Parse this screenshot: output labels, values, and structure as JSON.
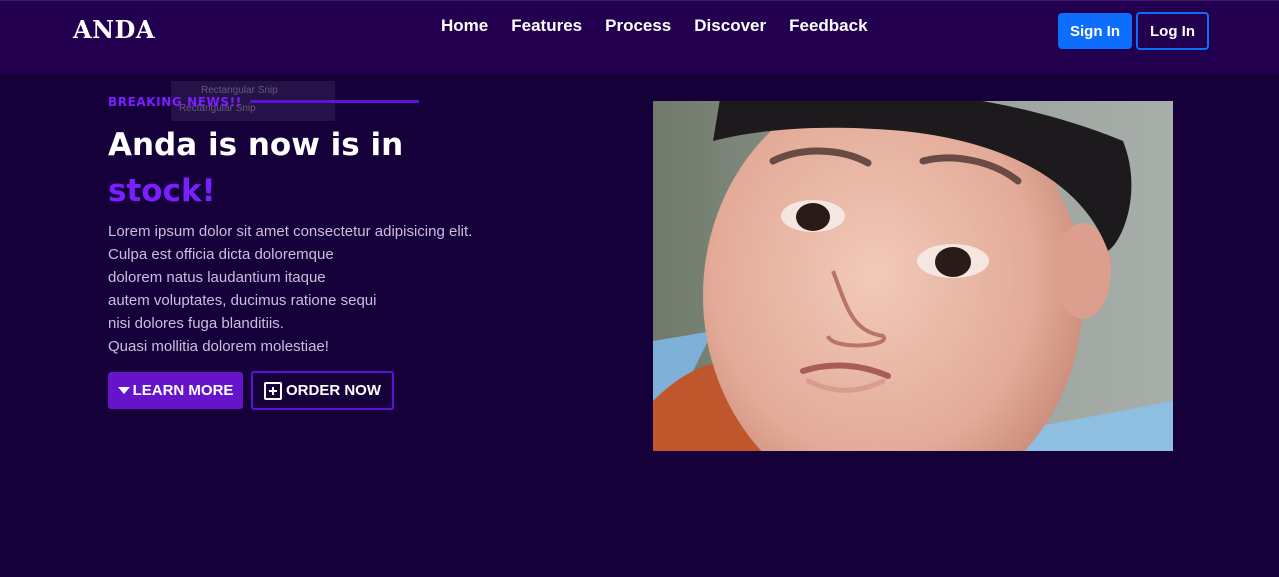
{
  "brand": "ANDA",
  "nav": {
    "links": [
      "Home",
      "Features",
      "Process",
      "Discover",
      "Feedback"
    ],
    "sign_in": "Sign In",
    "log_in": "Log In"
  },
  "ghost_snip": {
    "line1": "Rectangular Snip",
    "line2": "Rectangular Snip"
  },
  "hero": {
    "eyebrow": "BREAKING NEWS!!",
    "headline_main": "Anda is now is in",
    "headline_accent": "stock!",
    "lede": [
      "Lorem ipsum dolor sit amet consectetur adipisicing elit.",
      "Culpa est officia dicta doloremque",
      "dolorem natus laudantium itaque",
      "autem voluptates, ducimus ratione sequi",
      "nisi dolores fuga blanditiis.",
      "Quasi mollitia dolorem molestiae!"
    ],
    "learn_more": "LEARN MORE",
    "order_now": "ORDER NOW"
  },
  "colors": {
    "page_bg": "#15003a",
    "navbar_bg": "#22004f",
    "accent": "#7a1fff",
    "primary": "#0d6efd"
  },
  "icons": {
    "learn_more": "caret-down-icon",
    "order_now": "plus-square-icon"
  }
}
